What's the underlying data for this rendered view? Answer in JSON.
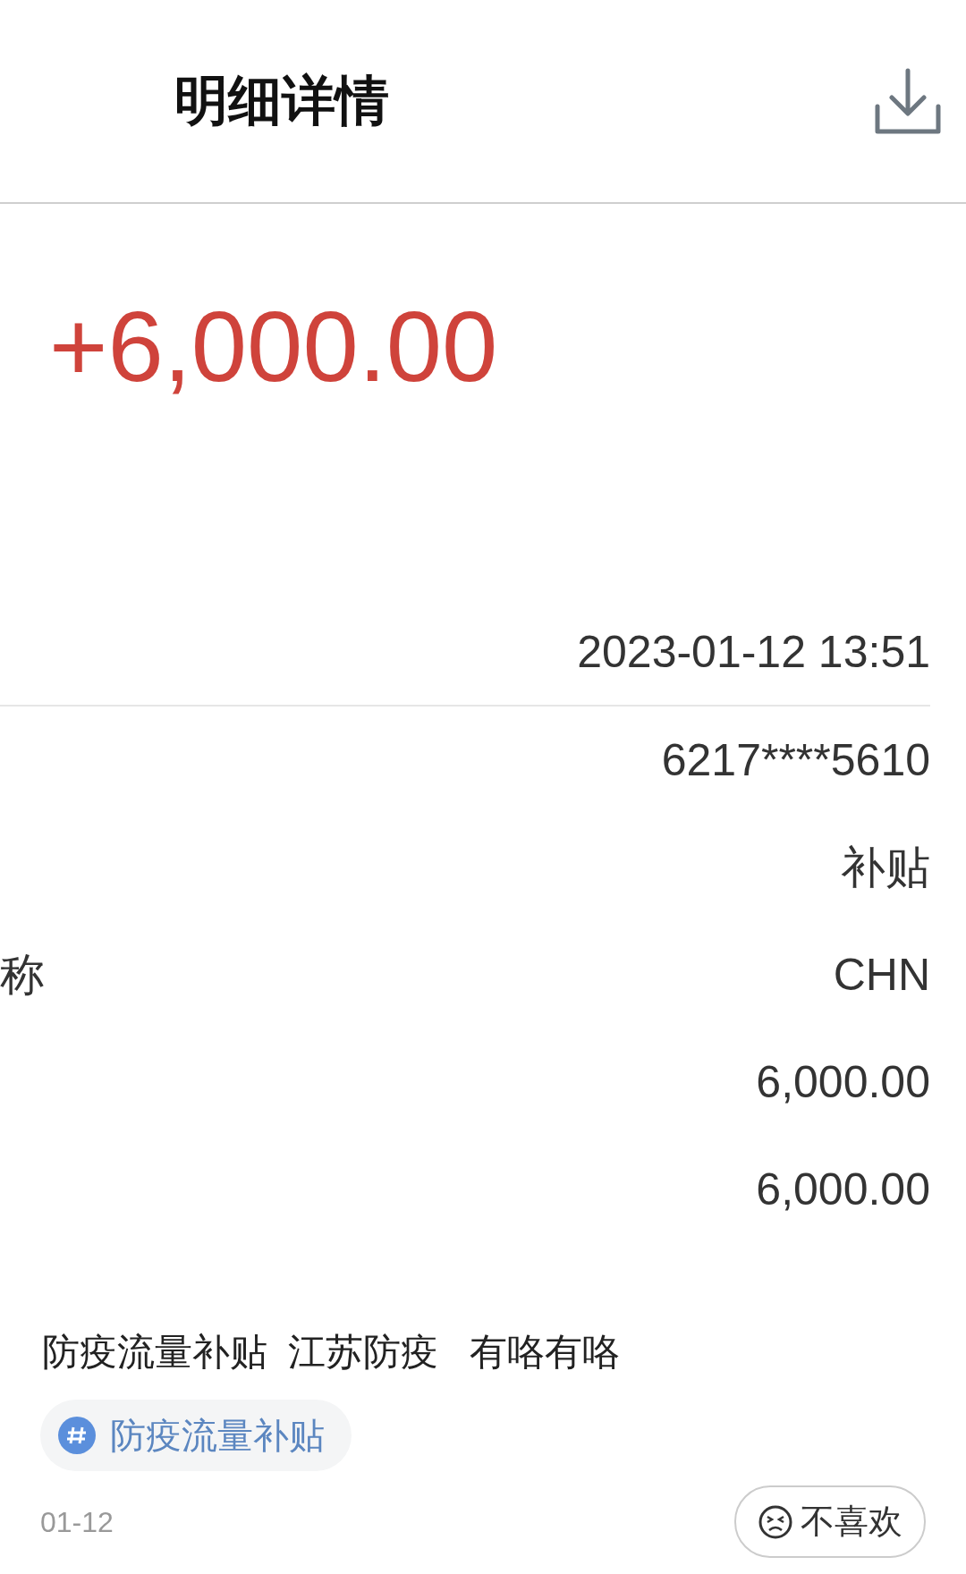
{
  "header": {
    "title": "明细详情"
  },
  "amount": "+6,000.00",
  "time": "2023-01-12 13:51",
  "details": [
    {
      "value": "6217****5610"
    },
    {
      "value": "补贴"
    },
    {
      "label": "称",
      "value": "CHN"
    },
    {
      "value": "6,000.00"
    },
    {
      "value": "6,000.00"
    }
  ],
  "post": {
    "text": "防疫流量补贴  江苏防疫   有咯有咯",
    "topic": "防疫流量补贴",
    "date": "01-12",
    "dislike_button": "不喜欢"
  }
}
